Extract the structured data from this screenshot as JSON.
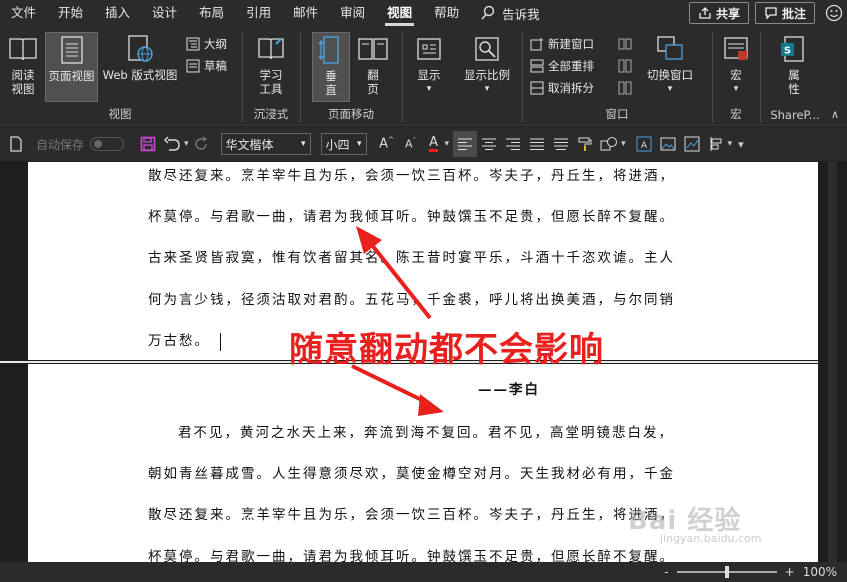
{
  "menubar": {
    "tabs": [
      "文件",
      "开始",
      "插入",
      "设计",
      "布局",
      "引用",
      "邮件",
      "审阅",
      "视图",
      "帮助"
    ],
    "active_tab": "视图",
    "tell_me": "告诉我",
    "share": "共享",
    "comments": "批注"
  },
  "ribbon": {
    "views": {
      "read_mode": "阅读\n视图",
      "print_layout": "页面视图",
      "web_layout": "Web 版式视图",
      "outline": "大纲",
      "draft": "草稿",
      "group_label": "视图"
    },
    "immersive": {
      "learning_tools": "学习\n工具",
      "group_label": "沉浸式"
    },
    "page_movement": {
      "vertical": "垂\n直",
      "side_to_side": "翻\n页",
      "group_label": "页面移动"
    },
    "show": {
      "label": "显示"
    },
    "zoom": {
      "label": "显示比例"
    },
    "window": {
      "new_window": "新建窗口",
      "arrange_all": "全部重排",
      "split": "取消拆分",
      "switch_windows": "切换窗口",
      "group_label": "窗口"
    },
    "macros": {
      "label": "宏",
      "group_label": "宏"
    },
    "sharepoint": {
      "label": "属\n性",
      "group_label": "ShareP..."
    }
  },
  "qat": {
    "autosave": "自动保存",
    "font_name": "华文楷体",
    "font_size": "小四"
  },
  "document": {
    "page1_lines": [
      "散尽还复来。烹羊宰牛且为乐，会须一饮三百杯。岑夫子，丹丘生，将进酒，",
      "杯莫停。与君歌一曲，请君为我倾耳听。钟鼓馔玉不足贵，但愿长醉不复醒。",
      "古来圣贤皆寂寞，惟有饮者留其名。陈王昔时宴平乐，斗酒十千恣欢谑。主人",
      "何为言少钱，径须沽取对君酌。五花马，千金裘，呼儿将出换美酒，与尔同销",
      "万古愁。"
    ],
    "author": "——李白",
    "page2_lines": [
      "君不见，黄河之水天上来，奔流到海不复回。君不见，高堂明镜悲白发，",
      "朝如青丝暮成雪。人生得意须尽欢，莫使金樽空对月。天生我材必有用，千金",
      "散尽还复来。烹羊宰牛且为乐，会须一饮三百杯。岑夫子，丹丘生，将进酒，",
      "杯莫停。与君歌一曲，请君为我倾耳听。钟鼓馔玉不足贵，但愿长醉不复醒。"
    ]
  },
  "annotation": {
    "text": "随意翻动都不会影响",
    "color": "#e8201e"
  },
  "statusbar": {
    "zoom_percent": "100%",
    "minus": "-",
    "plus": "+",
    "zoom_level": 1.0
  },
  "watermark": {
    "text": "Bai 经验",
    "sub": "jingyan.baidu.com"
  },
  "colors": {
    "accent_red": "#e8201e",
    "ribbon_bg": "#2b2b2b",
    "page_bg": "#ffffff",
    "save_icon": "#c74bd6"
  }
}
